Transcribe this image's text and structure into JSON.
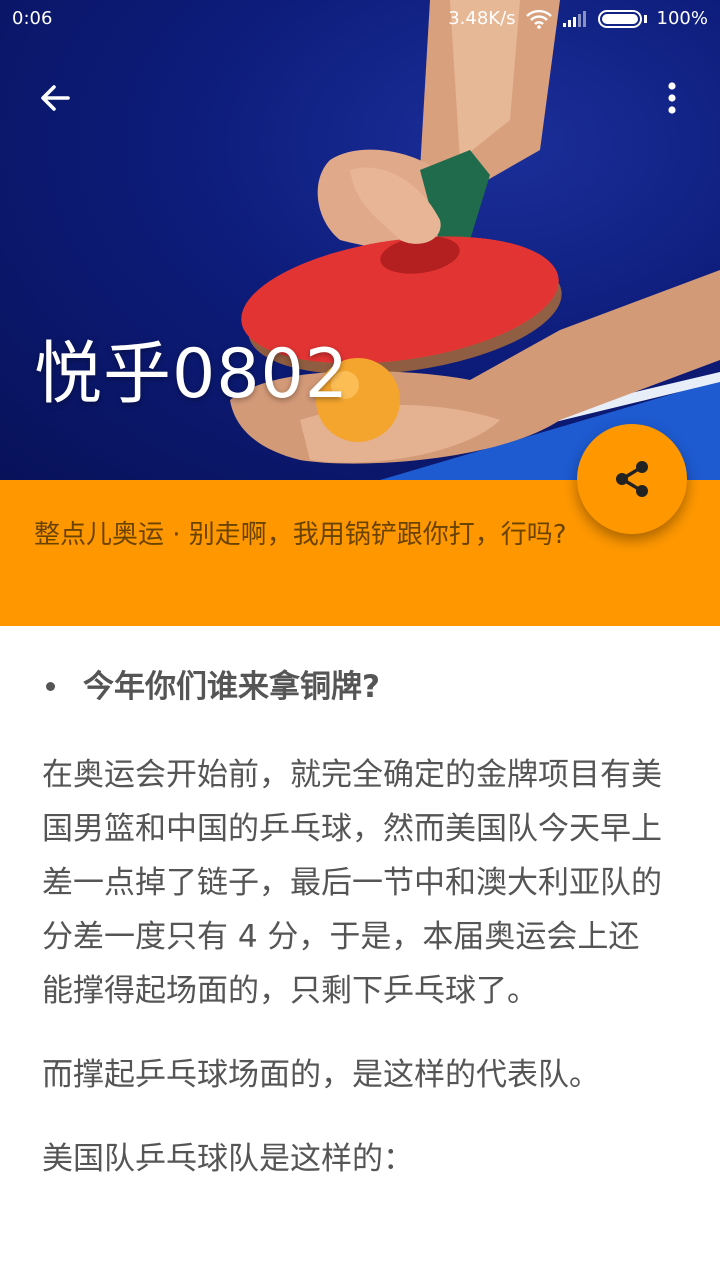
{
  "status_bar": {
    "time": "0:06",
    "network_speed": "3.48K/s",
    "battery": "100%",
    "icons": [
      "wifi-icon",
      "signal-icon",
      "battery-icon"
    ]
  },
  "toolbar": {
    "back_icon": "arrow-left-icon",
    "more_icon": "more-vert-icon"
  },
  "header": {
    "title": "悦乎0802"
  },
  "banner": {
    "subtitle": "整点儿奥运 · 别走啊，我用锅铲跟你打，行吗?"
  },
  "fab": {
    "icon": "share-icon"
  },
  "article": {
    "bullet": "今年你们谁来拿铜牌?",
    "paragraphs": [
      "在奥运会开始前，就完全确定的金牌项目有美国男篮和中国的乒乓球，然而美国队今天早上差一点掉了链子，最后一节中和澳大利亚队的分差一度只有 4 分，于是，本届奥运会上还能撑得起场面的，只剩下乒乓球了。",
      "而撑起乒乓球场面的，是这样的代表队。",
      "美国队乒乓球队是这样的："
    ]
  },
  "colors": {
    "accent": "#ff9800",
    "hero_background": "#0d1c7a",
    "text": "#555555"
  }
}
